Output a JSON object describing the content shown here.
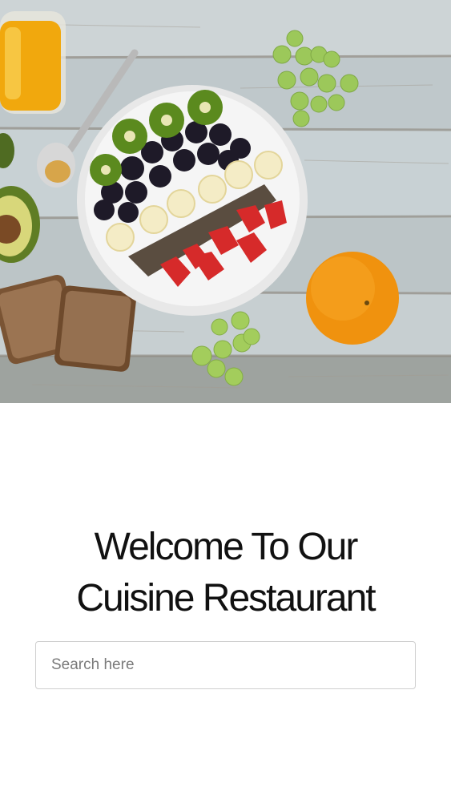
{
  "hero": {
    "image": "breakfast-bowl-on-wooden-table",
    "colors": {
      "wood": "#c9d0d2",
      "bowl": "#f2f2f2",
      "orange": "#f39a12",
      "grape": "#9cc85a"
    }
  },
  "headline": {
    "line1": "Welcome To Our",
    "line2": "Cuisine Restaurant"
  },
  "search": {
    "placeholder": "Search here",
    "value": ""
  }
}
